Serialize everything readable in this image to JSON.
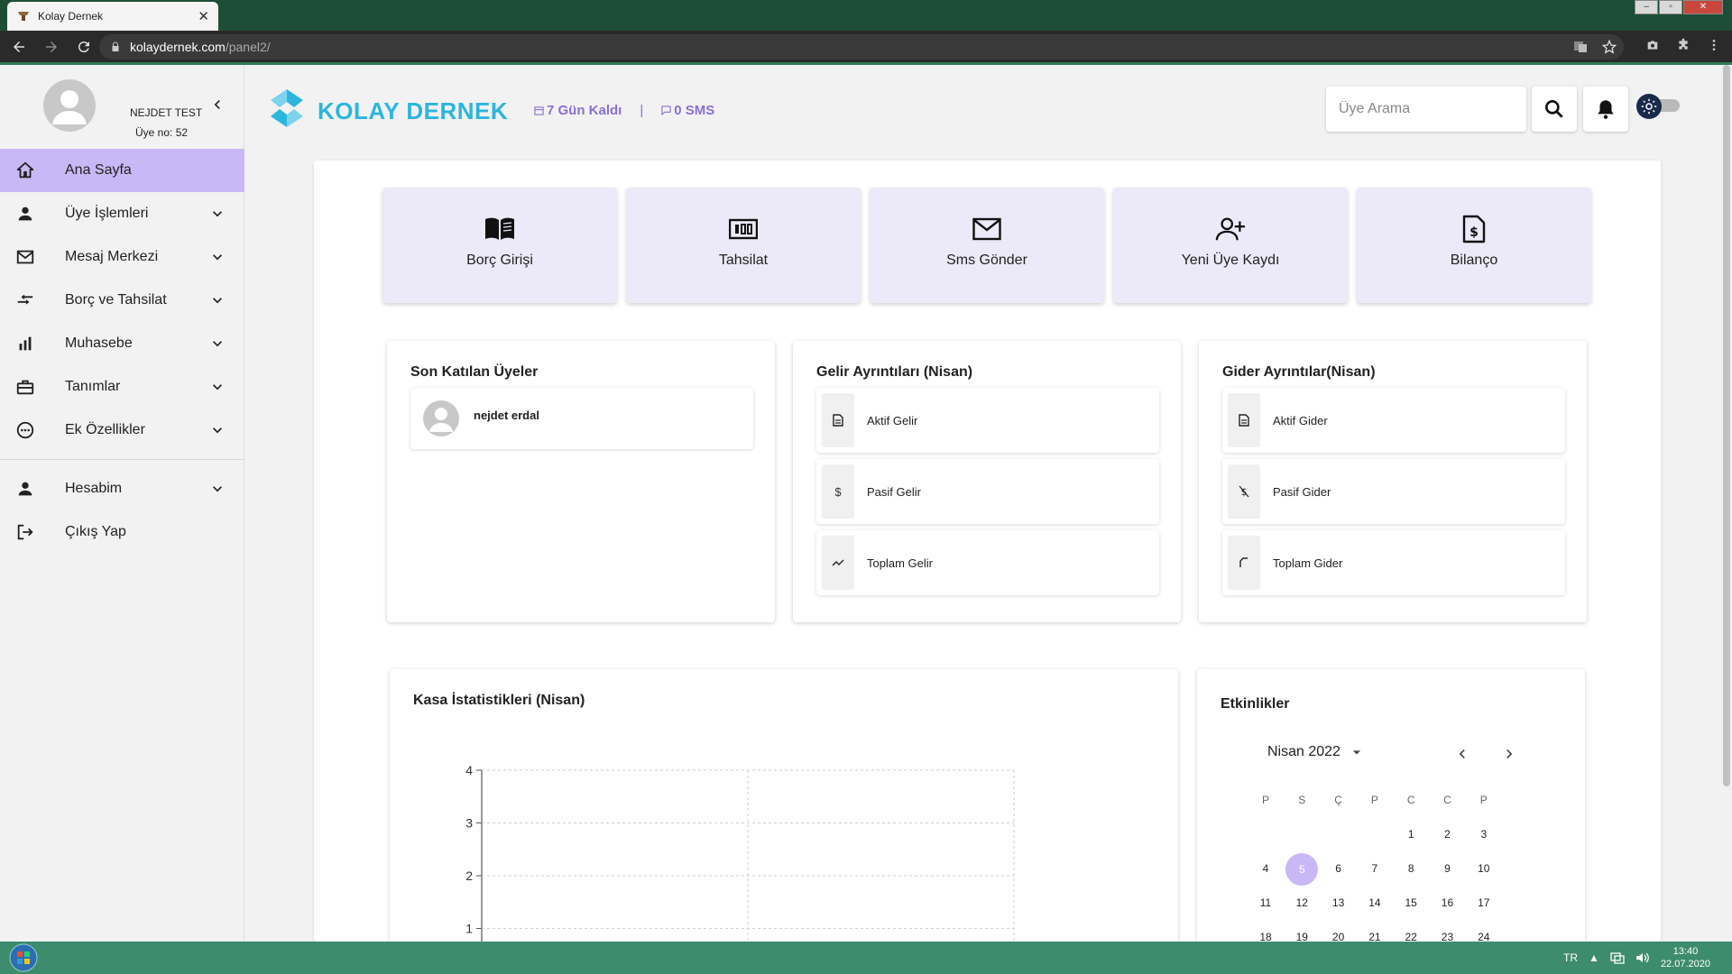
{
  "browser": {
    "tab_title": "Kolay Dernek",
    "url_host": "kolaydernek.com",
    "url_path": "/panel2/"
  },
  "profile": {
    "name": "NEJDET TEST",
    "member_no": "Üye no: 52"
  },
  "sidebar": {
    "items": [
      {
        "label": "Ana Sayfa",
        "icon": "home-icon",
        "active": true
      },
      {
        "label": "Üye İşlemleri",
        "icon": "person-icon"
      },
      {
        "label": "Mesaj Merkezi",
        "icon": "mail-icon"
      },
      {
        "label": "Borç ve Tahsilat",
        "icon": "swap-icon"
      },
      {
        "label": "Muhasebe",
        "icon": "bar-chart-icon"
      },
      {
        "label": "Tanımlar",
        "icon": "toolbox-icon"
      },
      {
        "label": "Ek Özellikler",
        "icon": "more-circle-icon"
      },
      {
        "label": "Hesabim",
        "icon": "person-icon"
      },
      {
        "label": "Çıkış Yap",
        "icon": "logout-icon"
      }
    ]
  },
  "header": {
    "brand": "KOLAY DERNEK",
    "days_left": "7 Gün Kaldı",
    "separator": "|",
    "sms": "0 SMS",
    "search_placeholder": "Üye Arama"
  },
  "quick_actions": [
    {
      "label": "Borç Girişi",
      "icon": "book-icon"
    },
    {
      "label": "Tahsilat",
      "icon": "cash-icon"
    },
    {
      "label": "Sms Gönder",
      "icon": "mail-icon"
    },
    {
      "label": "Yeni Üye Kaydı",
      "icon": "person-add-icon"
    },
    {
      "label": "Bilanço",
      "icon": "invoice-dollar-icon"
    }
  ],
  "recent_members": {
    "title": "Son Katılan Üyeler",
    "items": [
      {
        "name": "nejdet erdal"
      }
    ]
  },
  "income": {
    "title": "Gelir Ayrıntıları (Nisan)",
    "rows": [
      {
        "label": "Aktif Gelir",
        "icon": "document-icon"
      },
      {
        "label": "Pasif Gelir",
        "icon": "dollar-icon"
      },
      {
        "label": "Toplam Gelir",
        "icon": "trend-icon"
      }
    ]
  },
  "expense": {
    "title": "Gider Ayrıntılar(Nisan)",
    "rows": [
      {
        "label": "Aktif Gider",
        "icon": "document-icon"
      },
      {
        "label": "Pasif Gider",
        "icon": "dollar-off-icon"
      },
      {
        "label": "Toplam Gider",
        "icon": "trend-down-icon"
      }
    ]
  },
  "cash_stats": {
    "title": "Kasa İstatistikleri (Nisan)"
  },
  "chart_data": {
    "type": "line",
    "title": "",
    "xlabel": "",
    "ylabel": "",
    "ylim": [
      0,
      4
    ],
    "yticks": [
      "4",
      "3",
      "2",
      "1"
    ],
    "grid": true,
    "series": []
  },
  "events": {
    "title": "Etkinlikler",
    "month_label": "Nisan 2022",
    "weekdays": [
      "P",
      "S",
      "Ç",
      "P",
      "C",
      "C",
      "P"
    ],
    "weeks": [
      [
        "",
        "",
        "",
        "",
        "1",
        "2",
        "3"
      ],
      [
        "4",
        "5",
        "6",
        "7",
        "8",
        "9",
        "10"
      ],
      [
        "11",
        "12",
        "13",
        "14",
        "15",
        "16",
        "17"
      ],
      [
        "18",
        "19",
        "20",
        "21",
        "22",
        "23",
        "24"
      ]
    ],
    "selected_day": "5"
  },
  "taskbar": {
    "lang": "TR",
    "time": "13:40",
    "date": "22.07.2020"
  },
  "colors": {
    "accent": "#c9b8f5",
    "brand": "#2cb6dd",
    "header_info": "#8a6fd6"
  }
}
